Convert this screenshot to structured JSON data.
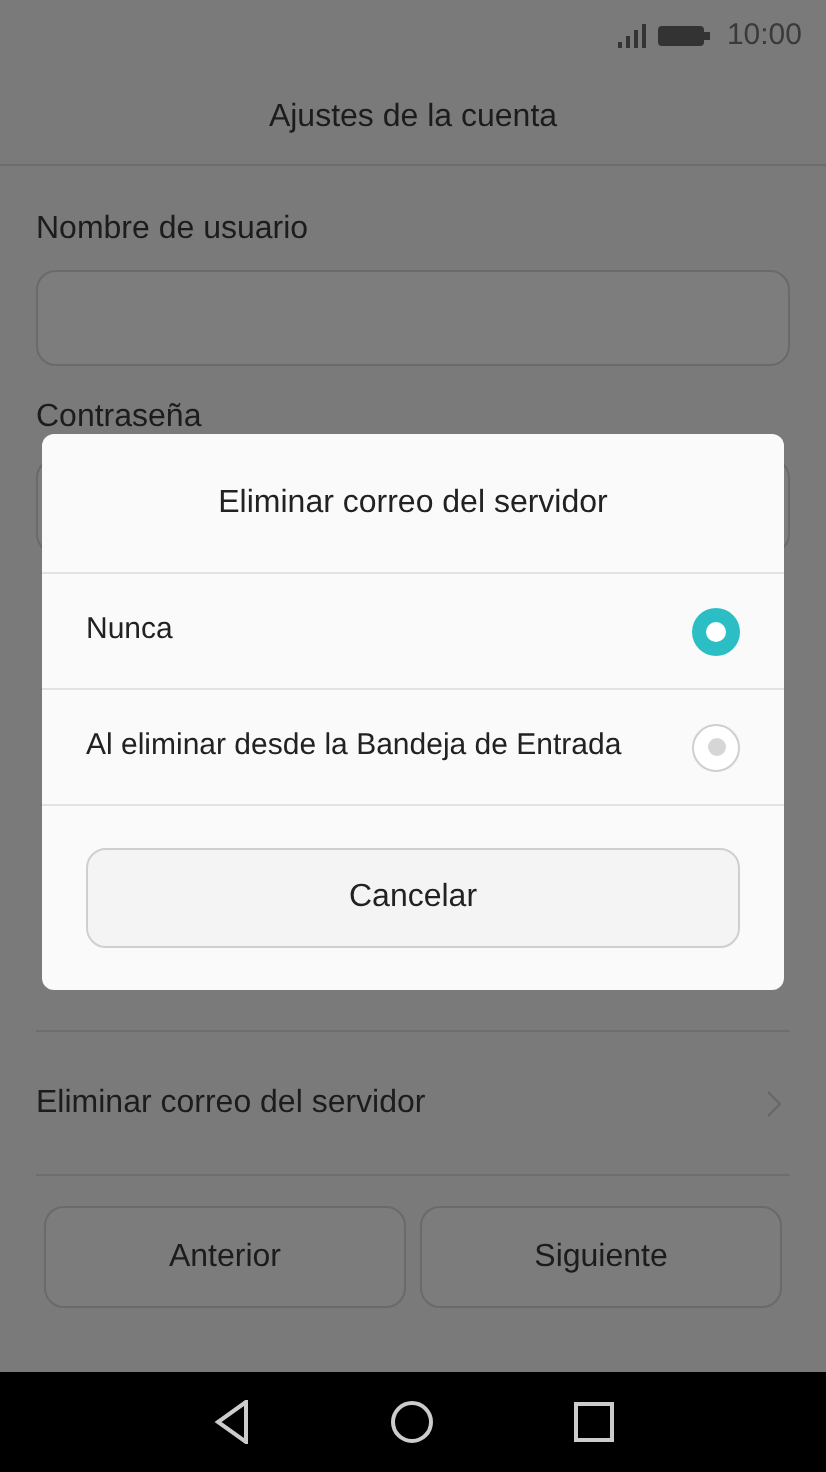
{
  "status_bar": {
    "time": "10:00"
  },
  "header": {
    "title": "Ajustes de la cuenta"
  },
  "form": {
    "fields": [
      {
        "label": "Nombre de usuario"
      },
      {
        "label": "Contraseña"
      }
    ]
  },
  "setting_row": {
    "label": "Eliminar correo del servidor"
  },
  "buttons": [
    "Anterior",
    "Siguiente"
  ],
  "dialog": {
    "title": "Eliminar correo del servidor",
    "options": [
      {
        "label": "Nunca",
        "selected": true
      },
      {
        "label": "Al eliminar desde la Bandeja de Entrada",
        "selected": false
      }
    ],
    "cancel": "Cancelar"
  }
}
